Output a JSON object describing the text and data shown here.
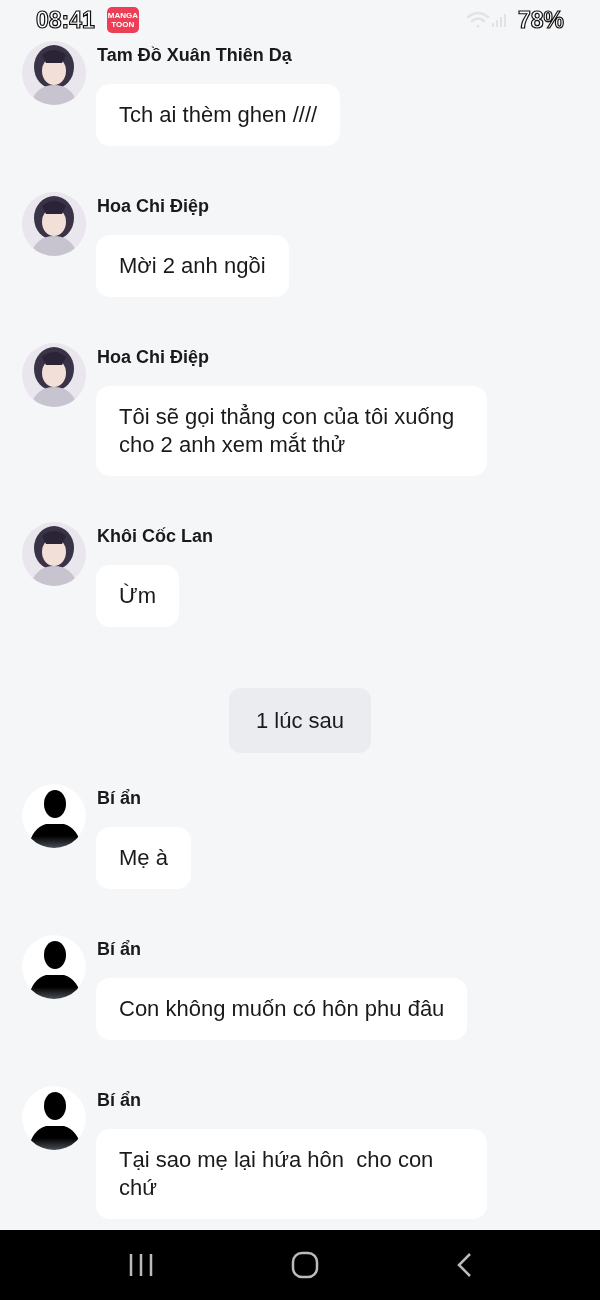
{
  "status_bar": {
    "time": "08:41",
    "app_badge": [
      "MANGA",
      "TOON"
    ],
    "battery": "78%"
  },
  "messages": [
    {
      "kind": "message",
      "sender": "Tam Đồ Xuân Thiên Dạ",
      "text": "Tch ai thèm ghen ////"
    },
    {
      "kind": "message",
      "sender": "Hoa Chi Điệp",
      "text": "Mời 2 anh ngồi"
    },
    {
      "kind": "message",
      "sender": "Hoa Chi Điệp",
      "text": "Tôi sẽ gọi thẳng con của tôi xuống cho 2 anh xem mắt thử"
    },
    {
      "kind": "message",
      "sender": "Khôi Cốc Lan",
      "text": "Ừm"
    },
    {
      "kind": "system",
      "text": "1 lúc sau"
    },
    {
      "kind": "message",
      "sender": "Bí ẩn",
      "avatar": {
        "kind": "silhouette"
      },
      "text": "Mẹ à"
    },
    {
      "kind": "message",
      "sender": "Bí ẩn",
      "avatar": {
        "kind": "silhouette"
      },
      "text": "Con không muốn có hôn phu đâu"
    },
    {
      "kind": "message",
      "sender": "Bí ẩn",
      "avatar": {
        "kind": "silhouette"
      },
      "text": "Tại sao mẹ lại hứa hôn  cho con chứ"
    }
  ]
}
